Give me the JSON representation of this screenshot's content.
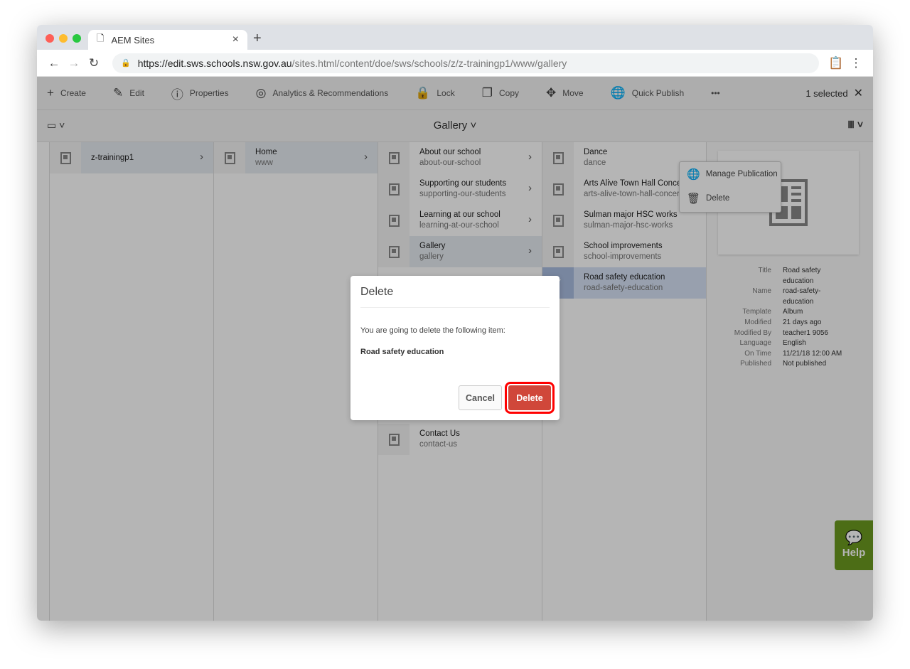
{
  "browser": {
    "tab_title": "AEM Sites",
    "url_host": "https://edit.sws.schools.nsw.gov.au",
    "url_path": "/sites.html/content/doe/sws/schools/z/z-trainingp1/www/gallery"
  },
  "toolbar": {
    "items": [
      {
        "label": "Create",
        "icon": "plus-icon"
      },
      {
        "label": "Edit",
        "icon": "pencil-icon"
      },
      {
        "label": "Properties",
        "icon": "info-icon"
      },
      {
        "label": "Analytics & Recommendations",
        "icon": "analytics-icon"
      },
      {
        "label": "Lock",
        "icon": "lock-icon"
      },
      {
        "label": "Copy",
        "icon": "copy-icon"
      },
      {
        "label": "Move",
        "icon": "move-icon"
      },
      {
        "label": "Quick Publish",
        "icon": "globe-icon"
      }
    ],
    "more": "•••",
    "selected": "1 selected"
  },
  "header": {
    "title": "Gallery"
  },
  "more_menu": [
    {
      "label": "Manage Publication"
    },
    {
      "label": "Delete"
    }
  ],
  "columns": [
    [
      {
        "title": "z-trainingp1",
        "chev": true,
        "state": "on"
      }
    ],
    [
      {
        "title": "Home",
        "sub": "www",
        "chev": true,
        "state": "on"
      }
    ],
    [
      {
        "title": "About our school",
        "sub": "about-our-school",
        "chev": true
      },
      {
        "title": "Supporting our students",
        "sub": "supporting-our-students",
        "chev": true
      },
      {
        "title": "Learning at our school",
        "sub": "learning-at-our-school",
        "chev": true
      },
      {
        "title": "Gallery",
        "sub": "gallery",
        "chev": true,
        "state": "on"
      }
    ],
    [
      {
        "title": "Dance",
        "sub": "dance"
      },
      {
        "title": "Arts Alive Town Hall Concert",
        "sub": "arts-alive-town-hall-concert"
      },
      {
        "title": "Sulman major HSC works",
        "sub": "sulman-major-hsc-works"
      },
      {
        "title": "School improvements",
        "sub": "school-improvements"
      },
      {
        "title": "Road safety education",
        "sub": "road-safety-education",
        "state": "check"
      }
    ]
  ],
  "contact": {
    "title": "Contact Us",
    "sub": "contact-us"
  },
  "preview": {
    "meta": [
      {
        "k": "Title",
        "v": "Road safety education"
      },
      {
        "k": "Name",
        "v": "road-safety-education"
      },
      {
        "k": "Template",
        "v": "Album"
      },
      {
        "k": "Modified",
        "v": "21 days ago"
      },
      {
        "k": "Modified By",
        "v": "teacher1 9056"
      },
      {
        "k": "Language",
        "v": "English"
      },
      {
        "k": "On Time",
        "v": "11/21/18 12:00 AM"
      },
      {
        "k": "Published",
        "v": "Not published"
      }
    ]
  },
  "help": "Help",
  "dialog": {
    "title": "Delete",
    "message": "You are going to delete the following item:",
    "item": "Road safety education",
    "cancel": "Cancel",
    "confirm": "Delete"
  },
  "colors": {
    "delete": "#d0473a",
    "highlight": "#ff0000",
    "help": "#6b9a1f"
  }
}
